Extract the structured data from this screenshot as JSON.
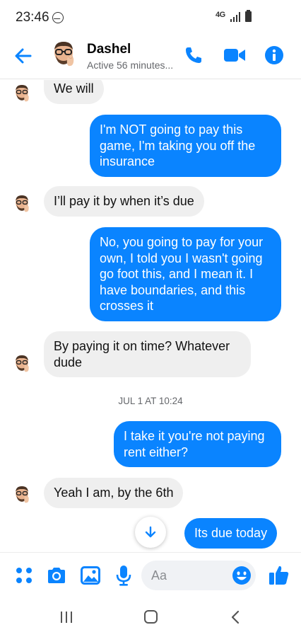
{
  "status_bar": {
    "time": "23:46",
    "network": "4G",
    "icons": [
      "messenger-notification-icon",
      "signal-icon",
      "battery-icon"
    ]
  },
  "header": {
    "contact_name": "Dashel",
    "contact_status": "Active 56 minutes...",
    "icons": [
      "back-arrow-icon",
      "phone-icon",
      "video-camera-icon",
      "info-icon"
    ]
  },
  "messages": [
    {
      "direction": "incoming",
      "lines": [
        "We will"
      ]
    },
    {
      "direction": "outgoing",
      "lines": [
        "I'm NOT going to pay this",
        "game, I'm taking you off the",
        "insurance"
      ]
    },
    {
      "direction": "incoming",
      "lines": [
        "I’ll pay it by when it’s due"
      ]
    },
    {
      "direction": "outgoing",
      "lines": [
        "No, you going to pay for your",
        "own, I told you I wasn't going",
        "go foot this, and I mean it. I",
        "have boundaries, and this",
        "crosses it"
      ]
    },
    {
      "direction": "incoming",
      "lines": [
        "By paying it on time? Whatever",
        "dude"
      ]
    },
    {
      "direction": "timestamp",
      "text": "JUL 1 AT 10:24"
    },
    {
      "direction": "outgoing",
      "lines": [
        "I take it you're not paying",
        "rent either?"
      ]
    },
    {
      "direction": "incoming",
      "lines": [
        "Yeah I am, by the 6th"
      ]
    },
    {
      "direction": "outgoing",
      "lines": [
        "Its due today"
      ]
    }
  ],
  "composer": {
    "placeholder": "Aa",
    "icons": [
      "menu-dots-icon",
      "camera-icon",
      "gallery-icon",
      "microphone-icon",
      "emoji-icon",
      "thumbs-up-icon"
    ]
  },
  "colors": {
    "accent": "#0a84ff",
    "incoming_bubble": "#efefef",
    "status_text": "#65676b"
  },
  "nav_bar": {
    "icons": [
      "recent-apps-icon",
      "home-icon",
      "back-icon"
    ]
  }
}
